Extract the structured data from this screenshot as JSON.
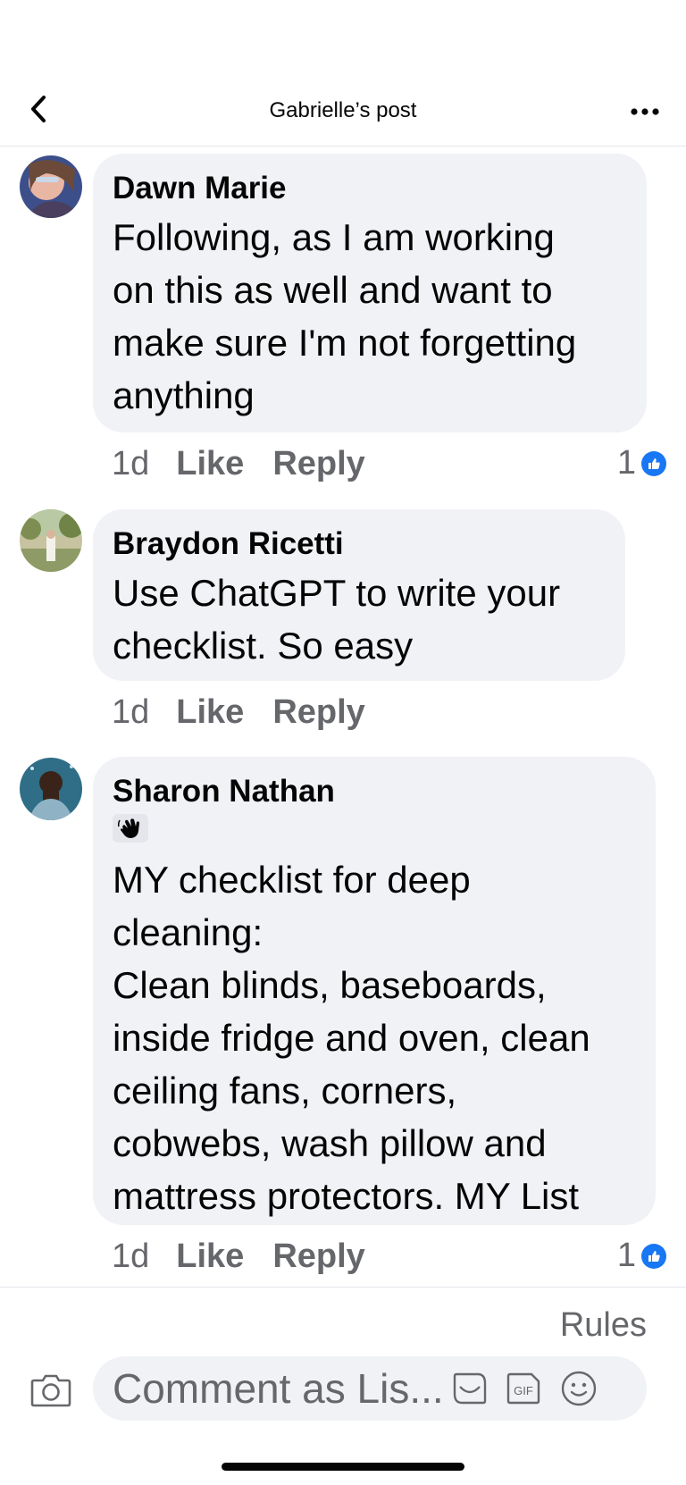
{
  "header": {
    "title": "Gabrielle’s post",
    "back_icon": "chevron-left-icon",
    "more_icon": "more-horizontal-icon"
  },
  "comments": [
    {
      "author": "Dawn Marie",
      "text": "Following, as I am working\non this as well and want to\nmake sure I'm not forgetting\nanything",
      "time": "1d",
      "like_label": "Like",
      "reply_label": "Reply",
      "reaction_count": "1"
    },
    {
      "author": "Braydon Ricetti",
      "text": "Use ChatGPT to write your\nchecklist. So easy",
      "time": "1d",
      "like_label": "Like",
      "reply_label": "Reply"
    },
    {
      "author": "Sharon Nathan",
      "emoji": "waving-hand-icon",
      "text": "MY checklist for deep\ncleaning:\nClean blinds, baseboards,\ninside fridge and oven, clean\nceiling fans, corners,\ncobwebs, wash pillow and\nmattress protectors. MY List",
      "time": "1d",
      "like_label": "Like",
      "reply_label": "Reply",
      "reaction_count": "1"
    }
  ],
  "footer": {
    "rules_label": "Rules",
    "composer_placeholder": "Comment as Lis...",
    "camera_icon": "camera-icon",
    "icons": [
      "sticker-icon",
      "gif-icon",
      "emoji-icon"
    ]
  },
  "colors": {
    "accent": "#1877f2",
    "bubble": "#f0f2f5",
    "secondary_text": "#65676b"
  }
}
